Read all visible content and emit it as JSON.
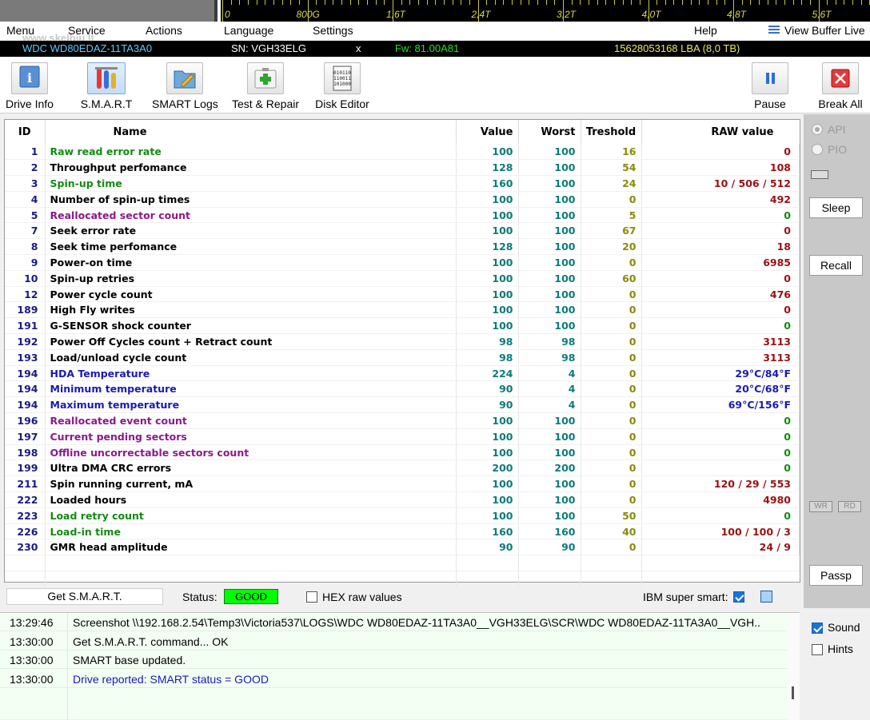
{
  "scale": {
    "labels": [
      "0",
      "800G",
      "1,6T",
      "2,4T",
      "3,2T",
      "4,0T",
      "4,8T",
      "5,6T"
    ]
  },
  "menu": {
    "items": [
      "Menu",
      "Service",
      "Actions",
      "Language",
      "Settings",
      "Help"
    ],
    "view_buffer_live": "View Buffer Live",
    "watermark": "www.skelbiu.lt"
  },
  "drive": {
    "model": "WDC WD80EDAZ-11TA3A0",
    "serial": "SN: VGH33ELG",
    "close_label": "x",
    "firmware": "Fw: 81.00A81",
    "capacity": "15628053168 LBA (8,0 TB)",
    "colors": {
      "model": "#5fc9ff",
      "serial": "#ffffff",
      "firmware": "#28e028",
      "capacity": "#e8e860"
    }
  },
  "toolbar": {
    "buttons": [
      {
        "label": "Drive Info",
        "icon": "info-icon"
      },
      {
        "label": "S.M.A.R.T",
        "icon": "test-tubes-icon",
        "active": true
      },
      {
        "label": "SMART Logs",
        "icon": "folder-pencil-icon"
      },
      {
        "label": "Test & Repair",
        "icon": "first-aid-kit-icon"
      },
      {
        "label": "Disk Editor",
        "icon": "binary-document-icon"
      },
      {
        "label": "Pause",
        "icon": "pause-icon"
      },
      {
        "label": "Break All",
        "icon": "close-icon"
      }
    ]
  },
  "table": {
    "headers": {
      "id": "ID",
      "name": "Name",
      "value": "Value",
      "worst": "Worst",
      "threshold": "Treshold",
      "raw": "RAW value"
    },
    "rows": [
      {
        "id": "1",
        "name": "Raw read error rate",
        "value": "100",
        "worst": "100",
        "threshold": "16",
        "raw": "0",
        "name_color": "green",
        "raw_color": "red"
      },
      {
        "id": "2",
        "name": "Throughput perfomance",
        "value": "128",
        "worst": "100",
        "threshold": "54",
        "raw": "108",
        "name_color": "black",
        "raw_color": "red"
      },
      {
        "id": "3",
        "name": "Spin-up time",
        "value": "160",
        "worst": "100",
        "threshold": "24",
        "raw": "10 / 506 / 512",
        "name_color": "green",
        "raw_color": "red"
      },
      {
        "id": "4",
        "name": "Number of spin-up times",
        "value": "100",
        "worst": "100",
        "threshold": "0",
        "raw": "492",
        "name_color": "black",
        "raw_color": "red"
      },
      {
        "id": "5",
        "name": "Reallocated sector count",
        "value": "100",
        "worst": "100",
        "threshold": "5",
        "raw": "0",
        "name_color": "purple",
        "raw_color": "green"
      },
      {
        "id": "7",
        "name": "Seek error rate",
        "value": "100",
        "worst": "100",
        "threshold": "67",
        "raw": "0",
        "name_color": "black",
        "raw_color": "red"
      },
      {
        "id": "8",
        "name": "Seek time perfomance",
        "value": "128",
        "worst": "100",
        "threshold": "20",
        "raw": "18",
        "name_color": "black",
        "raw_color": "red"
      },
      {
        "id": "9",
        "name": "Power-on time",
        "value": "100",
        "worst": "100",
        "threshold": "0",
        "raw": "6985",
        "name_color": "black",
        "raw_color": "red"
      },
      {
        "id": "10",
        "name": "Spin-up retries",
        "value": "100",
        "worst": "100",
        "threshold": "60",
        "raw": "0",
        "name_color": "black",
        "raw_color": "red"
      },
      {
        "id": "12",
        "name": "Power cycle count",
        "value": "100",
        "worst": "100",
        "threshold": "0",
        "raw": "476",
        "name_color": "black",
        "raw_color": "red"
      },
      {
        "id": "189",
        "name": "High Fly writes",
        "value": "100",
        "worst": "100",
        "threshold": "0",
        "raw": "0",
        "name_color": "black",
        "raw_color": "red"
      },
      {
        "id": "191",
        "name": "G-SENSOR shock counter",
        "value": "100",
        "worst": "100",
        "threshold": "0",
        "raw": "0",
        "name_color": "black",
        "raw_color": "green"
      },
      {
        "id": "192",
        "name": "Power Off Cycles count + Retract count",
        "value": "98",
        "worst": "98",
        "threshold": "0",
        "raw": "3113",
        "name_color": "black",
        "raw_color": "red"
      },
      {
        "id": "193",
        "name": "Load/unload cycle count",
        "value": "98",
        "worst": "98",
        "threshold": "0",
        "raw": "3113",
        "name_color": "black",
        "raw_color": "red"
      },
      {
        "id": "194",
        "name": "HDA Temperature",
        "value": "224",
        "worst": "4",
        "threshold": "0",
        "raw": "29°C/84°F",
        "name_color": "blue",
        "raw_color": "blue"
      },
      {
        "id": "194",
        "name": "Minimum temperature",
        "value": "90",
        "worst": "4",
        "threshold": "0",
        "raw": "20°C/68°F",
        "name_color": "blue",
        "raw_color": "blue"
      },
      {
        "id": "194",
        "name": "Maximum temperature",
        "value": "90",
        "worst": "4",
        "threshold": "0",
        "raw": "69°C/156°F",
        "name_color": "blue",
        "raw_color": "blue"
      },
      {
        "id": "196",
        "name": "Reallocated event count",
        "value": "100",
        "worst": "100",
        "threshold": "0",
        "raw": "0",
        "name_color": "purple",
        "raw_color": "green"
      },
      {
        "id": "197",
        "name": "Current pending sectors",
        "value": "100",
        "worst": "100",
        "threshold": "0",
        "raw": "0",
        "name_color": "purple",
        "raw_color": "green"
      },
      {
        "id": "198",
        "name": "Offline uncorrectable sectors count",
        "value": "100",
        "worst": "100",
        "threshold": "0",
        "raw": "0",
        "name_color": "purple",
        "raw_color": "green"
      },
      {
        "id": "199",
        "name": "Ultra DMA CRC errors",
        "value": "200",
        "worst": "200",
        "threshold": "0",
        "raw": "0",
        "name_color": "black",
        "raw_color": "green"
      },
      {
        "id": "211",
        "name": "Spin running current, mA",
        "value": "100",
        "worst": "100",
        "threshold": "0",
        "raw": "120 / 29 / 553",
        "name_color": "black",
        "raw_color": "red"
      },
      {
        "id": "222",
        "name": "Loaded hours",
        "value": "100",
        "worst": "100",
        "threshold": "0",
        "raw": "4980",
        "name_color": "black",
        "raw_color": "red"
      },
      {
        "id": "223",
        "name": "Load retry count",
        "value": "100",
        "worst": "100",
        "threshold": "50",
        "raw": "0",
        "name_color": "green",
        "raw_color": "green"
      },
      {
        "id": "226",
        "name": "Load-in time",
        "value": "160",
        "worst": "160",
        "threshold": "40",
        "raw": "100 / 100 / 3",
        "name_color": "green",
        "raw_color": "red"
      },
      {
        "id": "230",
        "name": "GMR head amplitude",
        "value": "90",
        "worst": "90",
        "threshold": "0",
        "raw": "24 / 9",
        "name_color": "black",
        "raw_color": "red"
      }
    ]
  },
  "footer": {
    "get_smart": "Get S.M.A.R.T.",
    "status_label": "Status:",
    "status_value": "GOOD",
    "hex_raw": "HEX raw values",
    "hex_checked": false,
    "ibm_label": "IBM super smart:",
    "ibm_checked": true
  },
  "right_panel": {
    "api_label": "API",
    "pio_label": "PIO",
    "sleep": "Sleep",
    "recall": "Recall",
    "wr": "WR",
    "rd": "RD",
    "passp": "Passp"
  },
  "log": {
    "lines": [
      {
        "time": "13:29:46",
        "msg": "Screenshot \\\\192.168.2.54\\Temp3\\Victoria537\\LOGS\\WDC WD80EDAZ-11TA3A0__VGH33ELG\\SCR\\WDC WD80EDAZ-11TA3A0__VGH..",
        "color": "#000000"
      },
      {
        "time": "13:30:00",
        "msg": "Get S.M.A.R.T. command... OK",
        "color": "#000000"
      },
      {
        "time": "13:30:00",
        "msg": "SMART base updated.",
        "color": "#000000"
      },
      {
        "time": "13:30:00",
        "msg": "Drive reported: SMART status = GOOD",
        "color": "#1a1ab0"
      }
    ]
  },
  "options": {
    "sound": "Sound",
    "sound_checked": true,
    "hints": "Hints",
    "hints_checked": false
  }
}
